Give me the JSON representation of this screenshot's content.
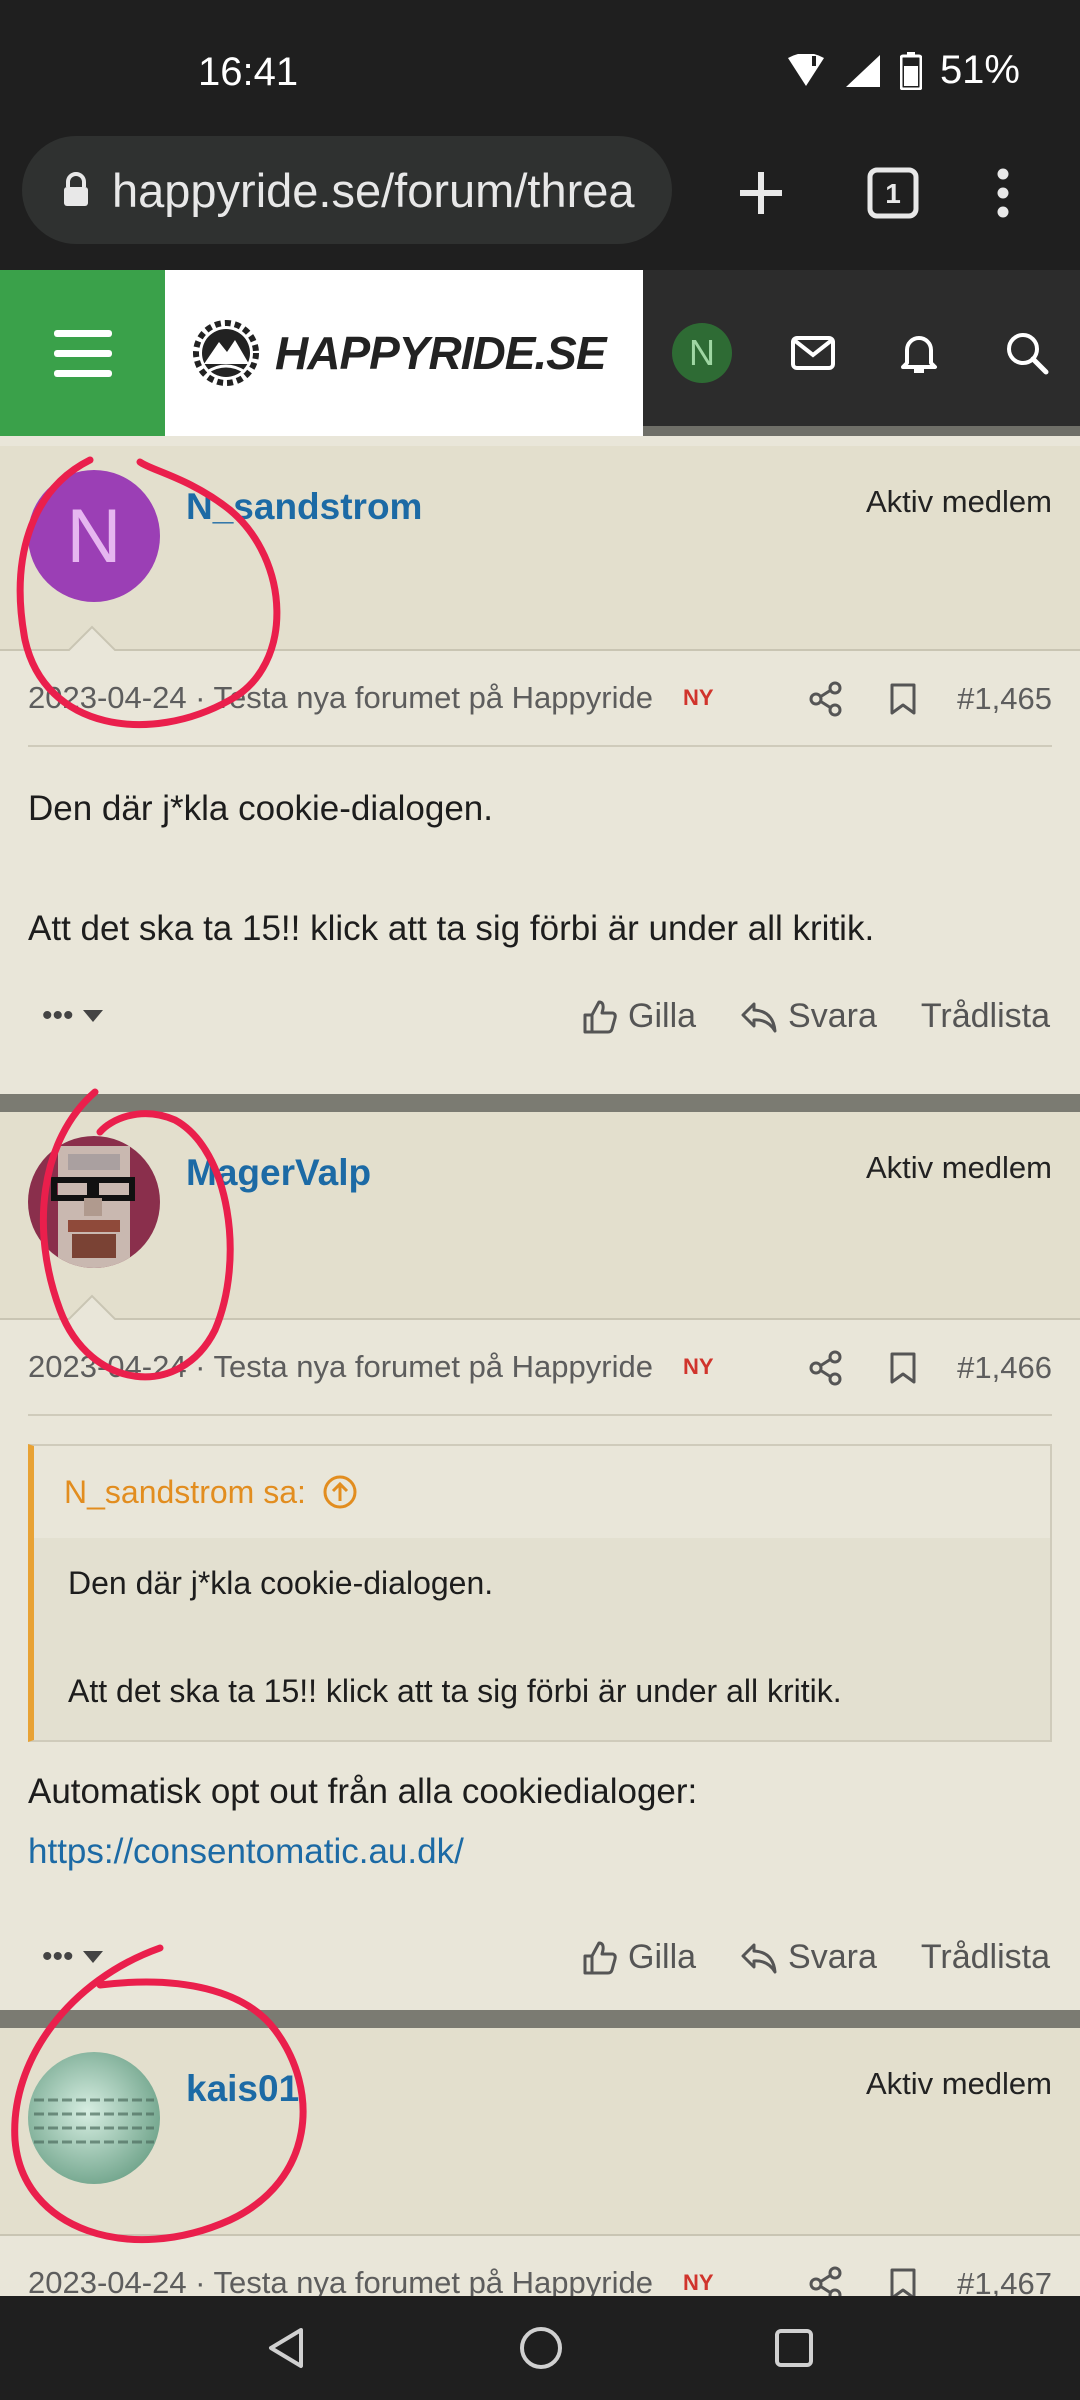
{
  "status_bar": {
    "time": "16:41",
    "battery": "51%"
  },
  "browser": {
    "url": "happyride.se/forum/threa",
    "tab_count": "1"
  },
  "site": {
    "logo_text": "HAPPYRIDE.SE",
    "user_initial": "N"
  },
  "posts": [
    {
      "avatar_initial": "N",
      "avatar_color": "#9b3fb5",
      "username": "N_sandstrom",
      "role": "Aktiv medlem",
      "date": "2023-04-24 · Testa nya forumet på Happyride",
      "new_badge": "NY",
      "number": "#1,465",
      "body_line1": "Den där j*kla cookie-dialogen.",
      "body_line2": "Att det ska ta 15!! klick att ta sig förbi är under all kritik.",
      "actions": {
        "more": "•••",
        "like": "Gilla",
        "reply": "Svara",
        "thread_list": "Trådlista"
      }
    },
    {
      "username": "MagerValp",
      "role": "Aktiv medlem",
      "date": "2023-04-24 · Testa nya forumet på Happyride",
      "new_badge": "NY",
      "number": "#1,466",
      "quote": {
        "author": "N_sandstrom sa:",
        "line1": "Den där j*kla cookie-dialogen.",
        "line2": "Att det ska ta 15!! klick att ta sig förbi är under all kritik."
      },
      "body_line1": "Automatisk opt out från alla cookiedialoger:",
      "link": "https://consentomatic.au.dk/",
      "actions": {
        "more": "•••",
        "like": "Gilla",
        "reply": "Svara",
        "thread_list": "Trådlista"
      }
    },
    {
      "username": "kais01",
      "role": "Aktiv medlem",
      "date": "2023-04-24 · Testa nya forumet på Happyride",
      "new_badge": "NY",
      "number": "#1,467"
    }
  ],
  "colors": {
    "accent_green": "#3aa14a",
    "username_blue": "#1c6aa5",
    "quote_orange": "#e28d1f",
    "annotation_red": "#ea1f4c"
  }
}
